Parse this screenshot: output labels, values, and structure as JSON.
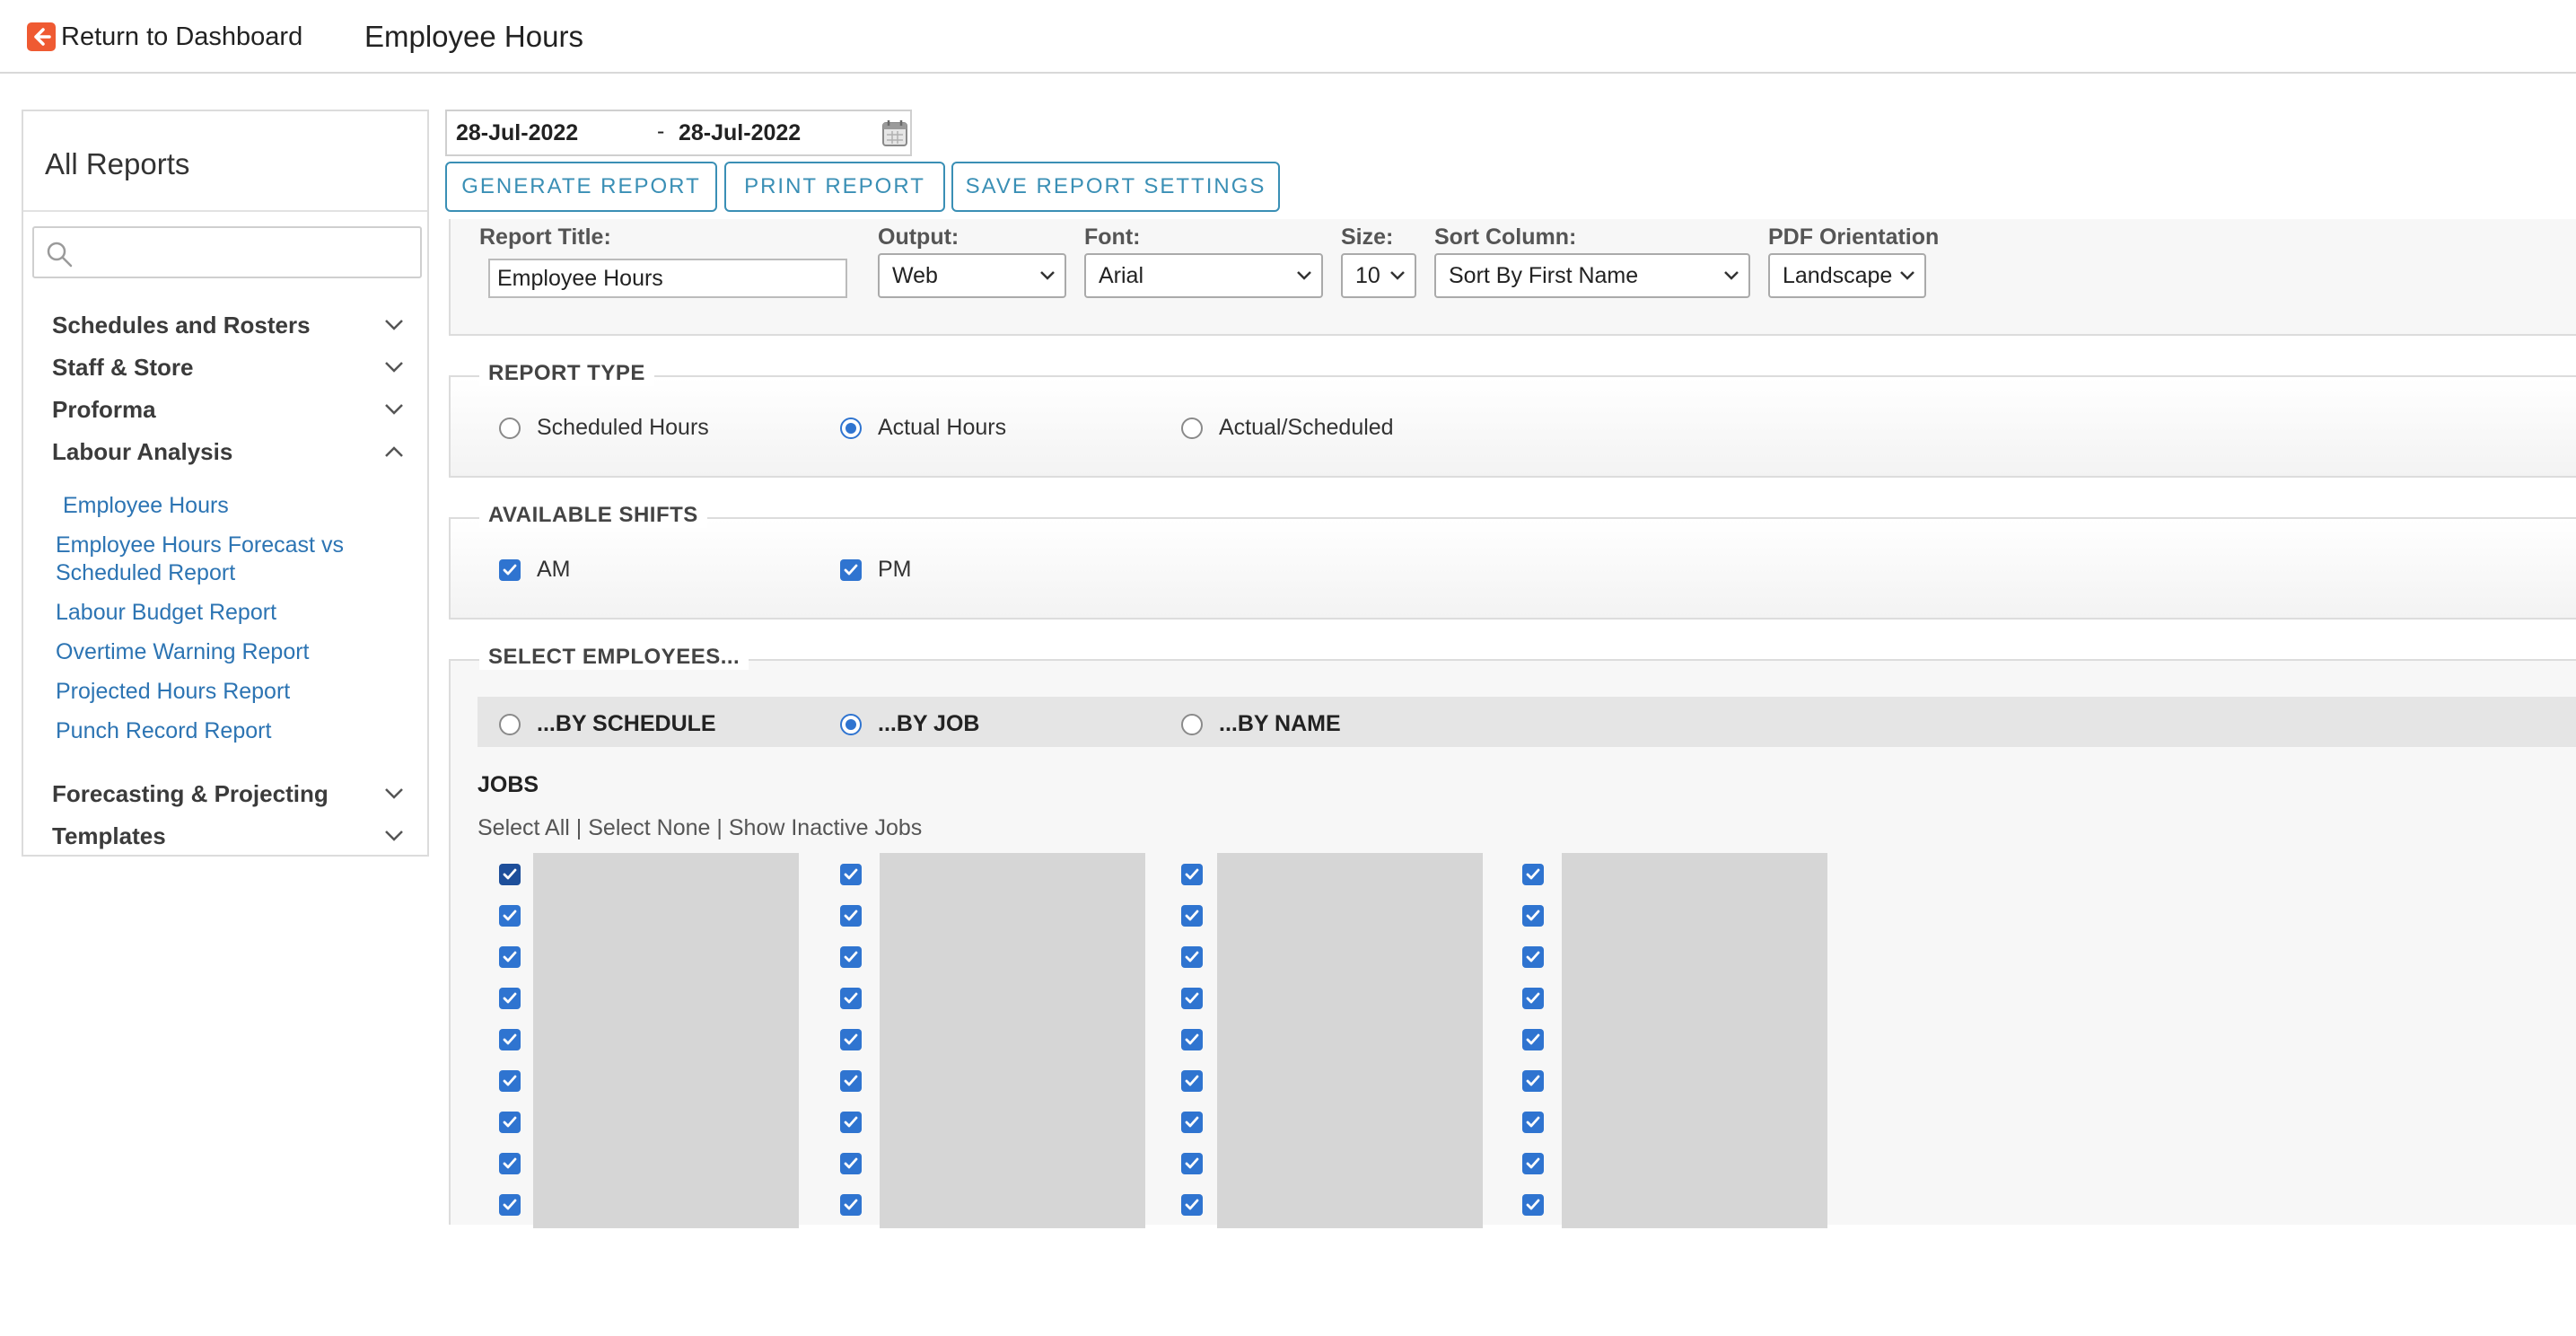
{
  "header": {
    "back_label": "Return to Dashboard",
    "page_title": "Employee Hours"
  },
  "sidebar": {
    "title": "All Reports",
    "search_placeholder": "",
    "categories": [
      {
        "label": "Schedules and Rosters",
        "expanded": false
      },
      {
        "label": "Staff & Store",
        "expanded": false
      },
      {
        "label": "Proforma",
        "expanded": false
      },
      {
        "label": "Labour Analysis",
        "expanded": true
      },
      {
        "label": "Forecasting & Projecting",
        "expanded": false
      },
      {
        "label": "Templates",
        "expanded": false
      }
    ],
    "labour_items": [
      "Employee Hours",
      "Employee Hours Forecast vs",
      "Scheduled Report",
      "Labour Budget Report",
      "Overtime Warning Report",
      "Projected Hours Report",
      "Punch Record Report"
    ]
  },
  "date_range": {
    "from": "28-Jul-2022",
    "separator": "-",
    "to": "28-Jul-2022"
  },
  "buttons": {
    "generate": "GENERATE REPORT",
    "print": "PRINT REPORT",
    "save": "SAVE REPORT SETTINGS"
  },
  "settings": {
    "title_label": "Report Title:",
    "title_value": "Employee Hours",
    "output_label": "Output:",
    "output_value": "Web",
    "font_label": "Font:",
    "font_value": "Arial",
    "size_label": "Size:",
    "size_value": "10",
    "sort_label": "Sort Column:",
    "sort_value": "Sort By First Name",
    "orientation_label": "PDF Orientation",
    "orientation_value": "Landscape"
  },
  "report_type": {
    "legend": "REPORT TYPE",
    "options": [
      "Scheduled Hours",
      "Actual Hours",
      "Actual/Scheduled"
    ],
    "selected": "Actual Hours"
  },
  "shifts": {
    "legend": "AVAILABLE SHIFTS",
    "options": [
      "AM",
      "PM"
    ],
    "checked": [
      "AM",
      "PM"
    ]
  },
  "employees": {
    "legend": "SELECT EMPLOYEES...",
    "options": [
      "...BY SCHEDULE",
      "...BY JOB",
      "...BY NAME"
    ],
    "selected": "...BY JOB",
    "jobs_title": "JOBS",
    "select_all": "Select All",
    "select_none": "Select None",
    "show_inactive": "Show Inactive Jobs",
    "link_separator": "|",
    "job_columns": 4,
    "job_rows": 9
  },
  "colors": {
    "accent": "#3a8fb5",
    "link": "#2c74b3",
    "checkbox": "#2f74d0",
    "back_icon": "#ef5a32"
  }
}
